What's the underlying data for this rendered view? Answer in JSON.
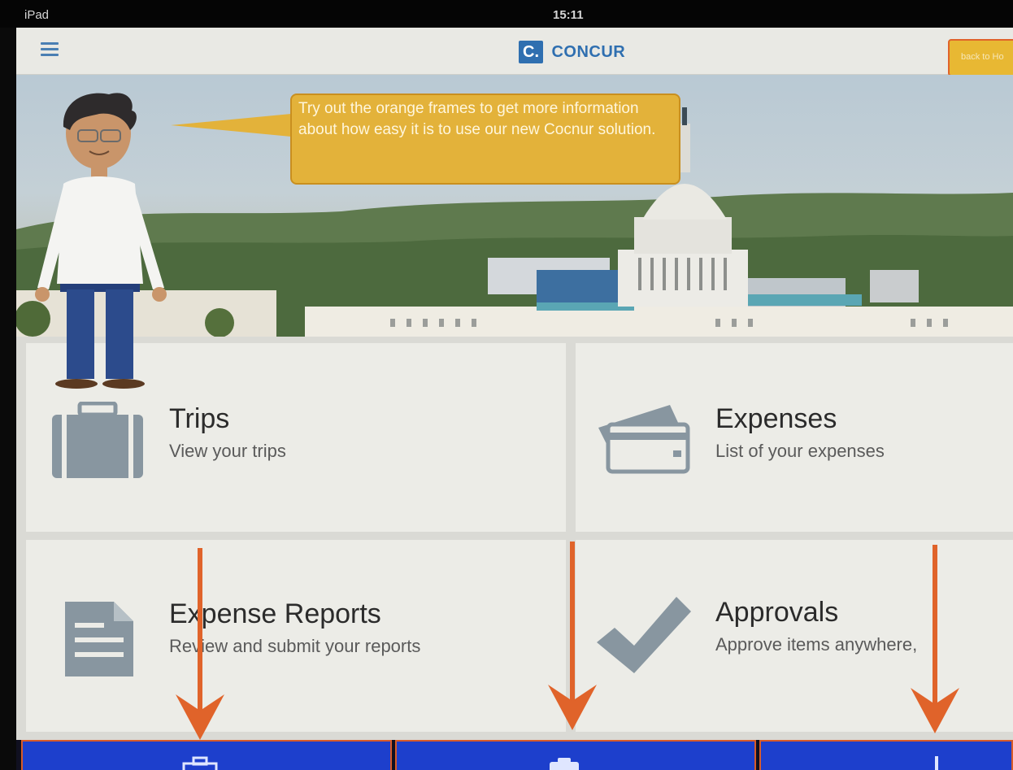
{
  "status_bar": {
    "device": "iPad",
    "time": "15:11"
  },
  "header": {
    "menu_icon": "hamburger-menu-icon",
    "logo_mark": "C.",
    "brand_name": "CONCUR",
    "back_button_label": "back to Ho"
  },
  "hero": {
    "callout_text": "Try out the orange frames to get more information about how easy it is to use our new Cocnur solution."
  },
  "tiles": [
    {
      "title": "Trips",
      "subtitle": "View your trips",
      "icon": "suitcase-icon"
    },
    {
      "title": "Expenses",
      "subtitle": "List of your expenses",
      "icon": "credit-card-icon"
    },
    {
      "title": "Expense Reports",
      "subtitle": "Review and submit your reports",
      "icon": "document-icon"
    },
    {
      "title": "Approvals",
      "subtitle": "Approve items anywhere,",
      "icon": "checkmark-icon"
    }
  ],
  "bottom_tabs": [
    {
      "icon": "suitcase-icon"
    },
    {
      "icon": "camera-icon"
    },
    {
      "icon": "plus-icon"
    }
  ],
  "colors": {
    "accent_blue": "#2f6fb0",
    "tip_yellow": "#e3b23a",
    "highlight_orange": "#e0632a",
    "tab_blue": "#1d3fcc",
    "icon_gray": "#8896a0"
  }
}
